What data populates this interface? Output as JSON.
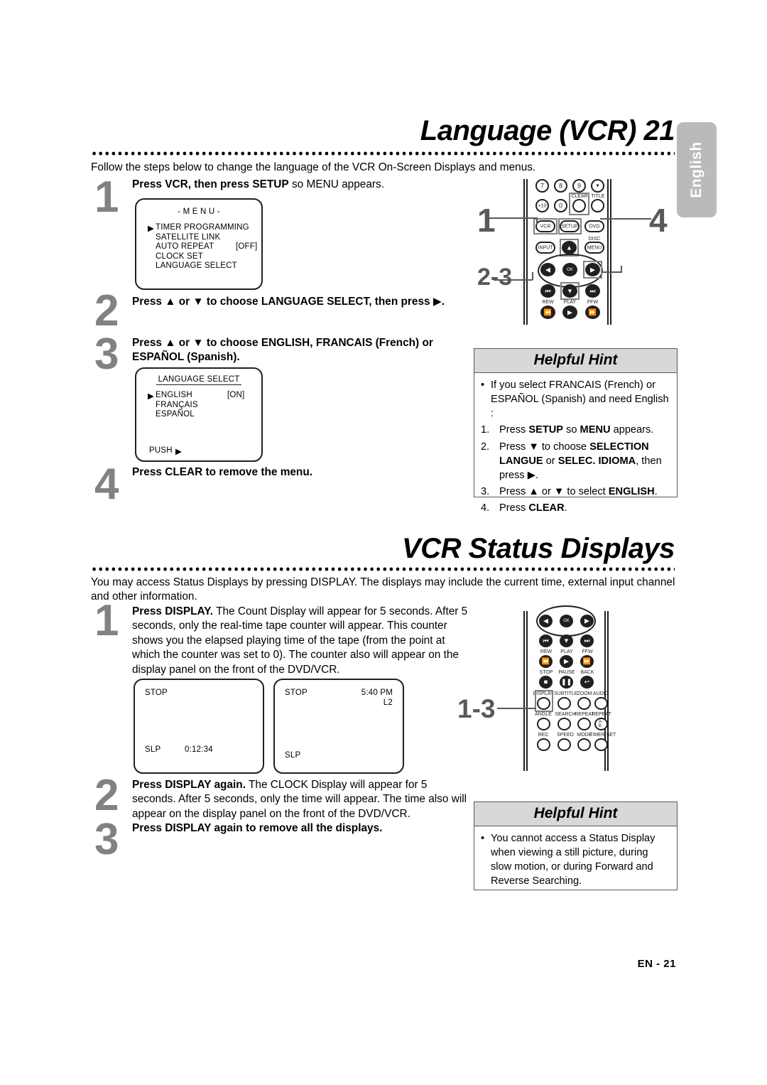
{
  "side_tab": {
    "label": "English"
  },
  "footer": {
    "page_label": "EN - 21"
  },
  "section1": {
    "title": "Language (VCR) 21",
    "intro": "Follow the steps below to change the language of the VCR On-Screen Displays and menus.",
    "steps": [
      {
        "number": "1",
        "text_html": "<b>Press VCR, then press SETUP</b> so MENU appears."
      },
      {
        "number": "2",
        "text_html": "<b>Press ▲ or ▼ to choose LANGUAGE SELECT, then press ▶.</b>"
      },
      {
        "number": "3",
        "text_html": "<b>Press ▲ or ▼ to choose ENGLISH, FRANCAIS (French) or ESPAÑOL (Spanish).</b>"
      },
      {
        "number": "4",
        "text_html": "<b>Press CLEAR to remove the menu.</b>"
      }
    ],
    "osd_menu": {
      "title": "- M E N U -",
      "items": [
        {
          "marker": "▶",
          "label": "TIMER PROGRAMMING",
          "value": ""
        },
        {
          "marker": "",
          "label": "SATELLITE LINK",
          "value": ""
        },
        {
          "marker": "",
          "label": "AUTO REPEAT",
          "value": "[OFF]"
        },
        {
          "marker": "",
          "label": "CLOCK SET",
          "value": ""
        },
        {
          "marker": "",
          "label": "LANGUAGE SELECT",
          "value": ""
        }
      ]
    },
    "osd_language": {
      "title": "LANGUAGE SELECT",
      "items": [
        {
          "marker": "▶",
          "label": "ENGLISH",
          "value": "[ON]"
        },
        {
          "marker": "",
          "label": "FRANÇAIS",
          "value": ""
        },
        {
          "marker": "",
          "label": "ESPAÑOL",
          "value": ""
        }
      ],
      "footer_label": "PUSH",
      "footer_glyph": "▶"
    },
    "hint": {
      "title": "Helpful Hint",
      "lines": [
        {
          "marker": "•",
          "text_html": "If you select FRANCAIS (French) or ESPAÑOL (Spanish) and need English :"
        },
        {
          "marker": "1.",
          "text_html": "Press <b>SETUP</b> so <b>MENU</b> appears."
        },
        {
          "marker": "2.",
          "text_html": "Press ▼ to choose <b>SELECTION LANGUE</b> or <b>SELEC. IDIOMA</b>, then press ▶."
        },
        {
          "marker": "3.",
          "text_html": "Press ▲ or ▼ to select <b>ENGLISH</b>."
        },
        {
          "marker": "4.",
          "text_html": "Press <b>CLEAR</b>."
        }
      ]
    },
    "remote_callouts": [
      {
        "id": "callout-1",
        "label": "1"
      },
      {
        "id": "callout-4",
        "label": "4"
      },
      {
        "id": "callout-2-3",
        "label": "2-3"
      }
    ],
    "remote_buttons": {
      "row_num_top": [
        "7",
        "8",
        "9",
        "▼"
      ],
      "row_num_bottom": [
        "+10",
        "0"
      ],
      "clear_label": "CLEAR",
      "title_label": "TITLE",
      "vcr_label": "VCR",
      "setup_label": "SETUP",
      "dvd_label": "DVD",
      "input_label": "INPUT",
      "disc_label": "DISC",
      "menu_label": "MENU",
      "ok_label": "OK",
      "rew_label": "REW",
      "play_label": "PLAY",
      "ffw_label": "FFW"
    }
  },
  "section2": {
    "title": "VCR Status Displays",
    "intro": "You may access Status Displays by pressing DISPLAY. The displays may include the current time, external input channel and other information.",
    "steps": [
      {
        "number": "1",
        "text_html": "<b>Press DISPLAY.</b> The Count Display will appear for 5 seconds. After 5 seconds, only the real-time tape counter will appear. This counter shows you the elapsed playing time of the tape (from the point at which the counter was set to 0). The counter also will appear on the display panel on the front of the DVD/VCR."
      },
      {
        "number": "2",
        "text_html": "<b>Press DISPLAY again.</b> The CLOCK Display will appear for 5 seconds. After 5 seconds, only the time will appear. The time also will appear on the display panel on the front of the DVD/VCR."
      },
      {
        "number": "3",
        "text_html": "<b>Press DISPLAY again to remove all the displays.</b>"
      }
    ],
    "osd_count": {
      "top_left": "STOP",
      "top_right": "",
      "bottom_left": "SLP",
      "bottom_right": "0:12:34"
    },
    "osd_clock": {
      "top_left": "STOP",
      "top_right": "5:40 PM",
      "top_right2": "L2",
      "bottom_left": "SLP",
      "bottom_right": ""
    },
    "hint": {
      "title": "Helpful Hint",
      "lines": [
        {
          "marker": "•",
          "text_html": "You cannot access a Status Display when viewing a still picture, during slow motion, or during Forward and Reverse Searching."
        }
      ]
    },
    "remote_callouts": [
      {
        "id": "callout-1-3",
        "label": "1-3"
      }
    ],
    "remote_buttons": {
      "ok_label": "OK",
      "rew_label": "REW",
      "play_label": "PLAY",
      "ffw_label": "FFW",
      "stop_label": "STOP",
      "pause_label": "PAUSE",
      "back_label": "BACK",
      "display_label": "DISPLAY",
      "subtitle_label": "SUBTITLE",
      "zoom_label": "ZOOM",
      "audio_label": "AUDIO",
      "angle_label": "ANGLE",
      "search_label": "SEARCH",
      "repeat_label": "REPEAT",
      "repeat_ab_label": "REPEAT",
      "ab_label": "A-B",
      "rec_label": "REC",
      "speed_label": "SPEED",
      "mode_label": "MODE",
      "timer_set_label": "TIMER SET"
    }
  }
}
